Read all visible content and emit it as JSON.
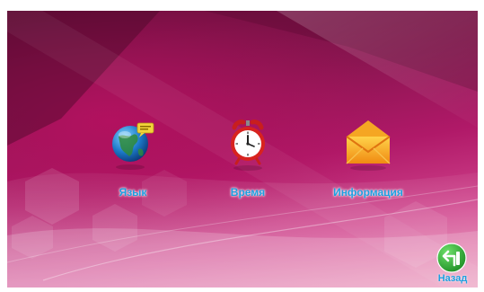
{
  "colors": {
    "label": "#1d9fe0",
    "background_dark": "#6b0d3b",
    "background_light": "#e57aa8"
  },
  "menu": {
    "items": [
      {
        "label": "Язык",
        "icon": "globe-icon"
      },
      {
        "label": "Время",
        "icon": "alarm-clock-icon"
      },
      {
        "label": "Информация",
        "icon": "envelope-icon"
      }
    ]
  },
  "back": {
    "label": "Назад",
    "icon": "back-arrow-icon"
  }
}
